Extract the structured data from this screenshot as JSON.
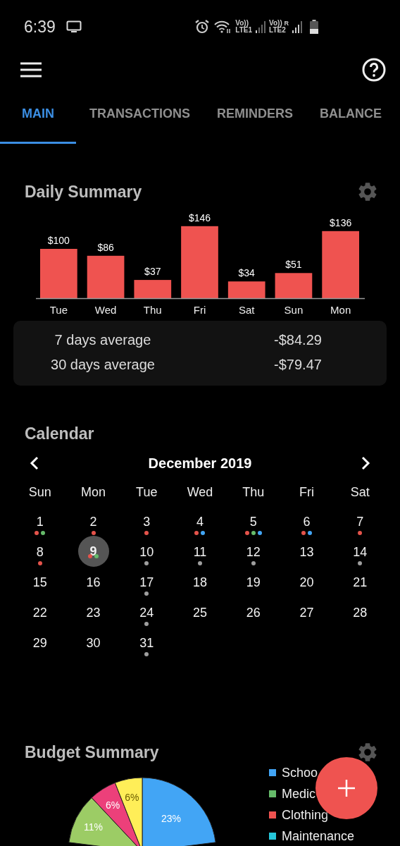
{
  "status_bar": {
    "time": "6:39",
    "sim1_voice": "Vo))",
    "sim1_network": "LTE1",
    "sim2_voice": "Vo))",
    "sim2_network": "LTE2",
    "sim2_roaming": "R"
  },
  "tabs": [
    {
      "label": "MAIN",
      "selected": true
    },
    {
      "label": "TRANSACTIONS",
      "selected": false
    },
    {
      "label": "REMINDERS",
      "selected": false
    },
    {
      "label": "BALANCE",
      "selected": false
    }
  ],
  "daily_summary": {
    "title": "Daily Summary",
    "chart_data": {
      "type": "bar",
      "categories": [
        "Tue",
        "Wed",
        "Thu",
        "Fri",
        "Sat",
        "Sun",
        "Mon"
      ],
      "values": [
        100,
        86,
        37,
        146,
        34,
        51,
        136
      ],
      "value_labels": [
        "$100",
        "$86",
        "$37",
        "$146",
        "$34",
        "$51",
        "$136"
      ]
    },
    "averages": [
      {
        "label": "7 days average",
        "value": "-$84.29"
      },
      {
        "label": "30 days average",
        "value": "-$79.47"
      }
    ]
  },
  "calendar": {
    "title": "Calendar",
    "month": "December 2019",
    "weekdays": [
      "Sun",
      "Mon",
      "Tue",
      "Wed",
      "Thu",
      "Fri",
      "Sat"
    ],
    "days": [
      {
        "day": "1",
        "selected": false,
        "dots": [
          {
            "color": "#e5534b"
          },
          {
            "color": "#66bb6a"
          }
        ]
      },
      {
        "day": "2",
        "selected": false,
        "dots": [
          {
            "color": "#e5534b"
          }
        ]
      },
      {
        "day": "3",
        "selected": false,
        "dots": [
          {
            "color": "#e5534b"
          }
        ]
      },
      {
        "day": "4",
        "selected": false,
        "dots": [
          {
            "color": "#e5534b"
          },
          {
            "color": "#42a5f5"
          }
        ]
      },
      {
        "day": "5",
        "selected": false,
        "dots": [
          {
            "color": "#e5534b"
          },
          {
            "color": "#66bb6a"
          },
          {
            "color": "#42a5f5"
          }
        ]
      },
      {
        "day": "6",
        "selected": false,
        "dots": [
          {
            "color": "#e5534b"
          },
          {
            "color": "#42a5f5"
          }
        ]
      },
      {
        "day": "7",
        "selected": false,
        "dots": [
          {
            "color": "#e5534b"
          }
        ]
      },
      {
        "day": "8",
        "selected": false,
        "dots": [
          {
            "color": "#e5534b"
          }
        ]
      },
      {
        "day": "9",
        "selected": true,
        "dots": [
          {
            "color": "#e5534b"
          },
          {
            "color": "#66bb6a"
          }
        ]
      },
      {
        "day": "10",
        "selected": false,
        "dots": [
          {
            "color": "#9e9e9e"
          }
        ]
      },
      {
        "day": "11",
        "selected": false,
        "dots": [
          {
            "color": "#9e9e9e"
          }
        ]
      },
      {
        "day": "12",
        "selected": false,
        "dots": [
          {
            "color": "#9e9e9e"
          }
        ]
      },
      {
        "day": "13",
        "selected": false
      },
      {
        "day": "14",
        "selected": false,
        "dots": [
          {
            "color": "#9e9e9e"
          }
        ]
      },
      {
        "day": "15",
        "selected": false
      },
      {
        "day": "16",
        "selected": false
      },
      {
        "day": "17",
        "selected": false,
        "dots": [
          {
            "color": "#9e9e9e"
          }
        ]
      },
      {
        "day": "18",
        "selected": false
      },
      {
        "day": "19",
        "selected": false
      },
      {
        "day": "20",
        "selected": false
      },
      {
        "day": "21",
        "selected": false
      },
      {
        "day": "22",
        "selected": false
      },
      {
        "day": "23",
        "selected": false
      },
      {
        "day": "24",
        "selected": false,
        "dots": [
          {
            "color": "#9e9e9e"
          }
        ]
      },
      {
        "day": "25",
        "selected": false
      },
      {
        "day": "26",
        "selected": false
      },
      {
        "day": "27",
        "selected": false
      },
      {
        "day": "28",
        "selected": false
      },
      {
        "day": "29",
        "selected": false
      },
      {
        "day": "30",
        "selected": false
      },
      {
        "day": "31",
        "selected": false,
        "dots": [
          {
            "color": "#9e9e9e"
          }
        ]
      }
    ]
  },
  "budget_summary": {
    "title": "Budget Summary",
    "chart_data": {
      "type": "pie",
      "values": [
        23,
        11,
        6,
        6
      ],
      "value_labels": [
        "23%",
        "11%",
        "6%",
        "6%"
      ],
      "colors": [
        "#42a5f5",
        "#9ccc65",
        "#ec407a",
        "#ffee58"
      ]
    },
    "legend": [
      {
        "label": "Schoo",
        "color": "#42a5f5"
      },
      {
        "label": "Medic",
        "color": "#66bb6a"
      },
      {
        "label": "Clothing",
        "color": "#ef5350"
      },
      {
        "label": "Maintenance",
        "color": "#26c6da"
      }
    ]
  }
}
